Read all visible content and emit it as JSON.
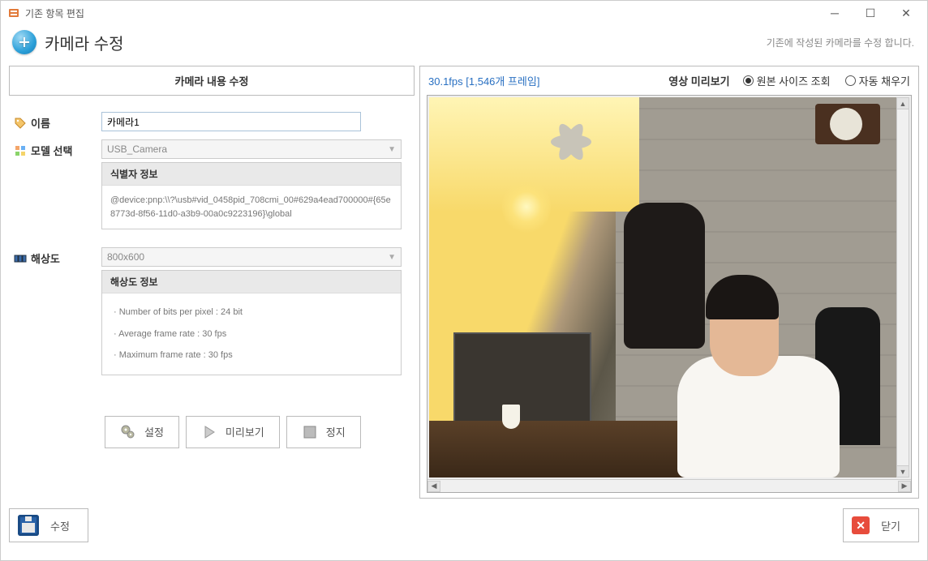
{
  "window": {
    "title": "기존 항목 편집"
  },
  "header": {
    "title": "카메라 수정",
    "subtitle": "기존에 작성된 카메라를 수정 합니다."
  },
  "left": {
    "panel_title": "카메라 내용 수정",
    "name_label": "이름",
    "name_value": "카메라1",
    "model_label": "모델 선택",
    "model_value": "USB_Camera",
    "identifier_header": "식별자 정보",
    "identifier_body": "@device:pnp:\\\\?\\usb#vid_0458pid_708cmi_00#629a4ead700000#{65e8773d-8f56-11d0-a3b9-00a0c9223196}\\global",
    "resolution_label": "해상도",
    "resolution_value": "800x600",
    "resolution_info_header": "해상도 정보",
    "resolution_rows": {
      "r1": "· Number of bits per pixel : 24 bit",
      "r2": "· Average frame rate : 30 fps",
      "r3": "· Maximum frame rate : 30 fps"
    },
    "buttons": {
      "settings": "설정",
      "preview": "미리보기",
      "stop": "정지"
    }
  },
  "right": {
    "stats": "30.1fps [1,546개 프레임]",
    "title": "영상 미리보기",
    "radio_original": "원본 사이즈 조회",
    "radio_autofill": "자동 채우기"
  },
  "footer": {
    "save": "수정",
    "close": "닫기"
  }
}
